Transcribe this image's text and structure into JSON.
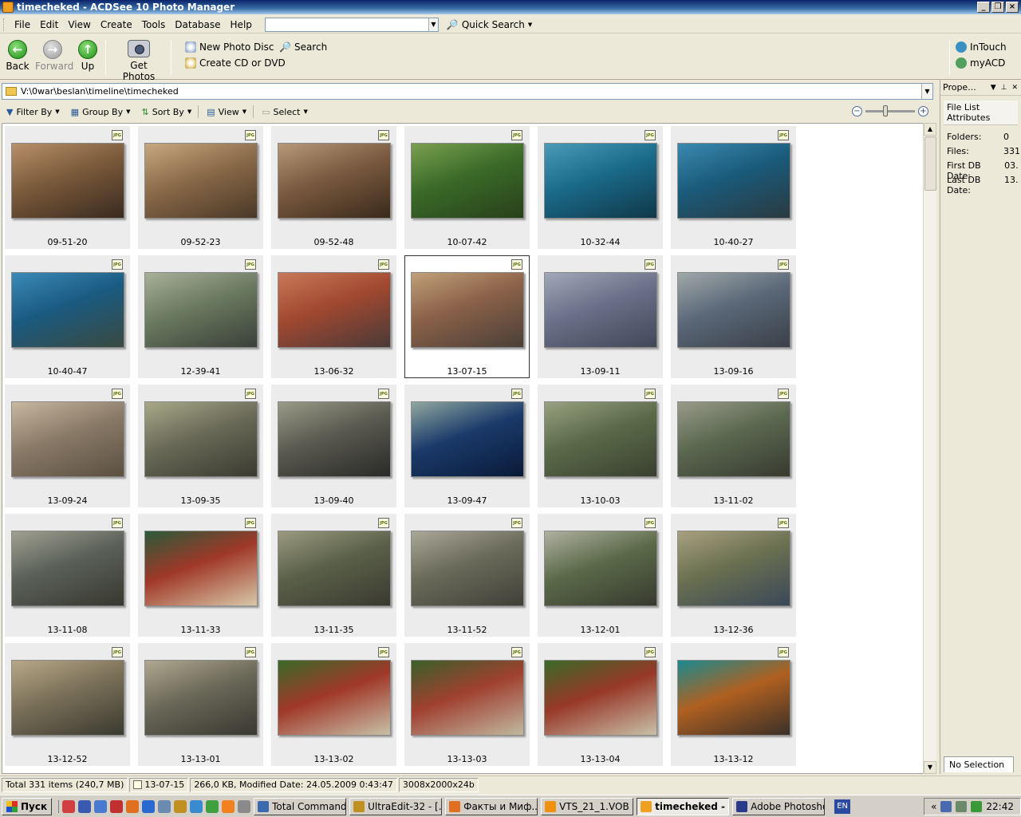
{
  "window": {
    "title": "timecheked - ACDSee 10 Photo Manager"
  },
  "menu": {
    "items": [
      "File",
      "Edit",
      "View",
      "Create",
      "Tools",
      "Database",
      "Help"
    ],
    "search_value": "",
    "quick_search": "Quick Search"
  },
  "toolbar": {
    "back": "Back",
    "forward": "Forward",
    "up": "Up",
    "get_photos": "Get Photos",
    "new_photo_disc": "New Photo Disc",
    "create_cd": "Create CD or DVD",
    "search": "Search",
    "intouch": "InTouch",
    "myacd": "myACD"
  },
  "address": {
    "path": "V:\\0war\\beslan\\timeline\\timecheked"
  },
  "filterbar": {
    "filter_by": "Filter By",
    "group_by": "Group By",
    "sort_by": "Sort By",
    "view": "View",
    "select": "Select"
  },
  "files": {
    "badge": "JPG",
    "selected": "13-07-15",
    "items": [
      {
        "name": "09-51-20",
        "colors": [
          "#7a5a3a",
          "#b8906a",
          "#3a2a20"
        ]
      },
      {
        "name": "09-52-23",
        "colors": [
          "#8a6a48",
          "#c8a880",
          "#4a3828"
        ]
      },
      {
        "name": "09-52-48",
        "colors": [
          "#7a5a40",
          "#b89878",
          "#3a2a1a"
        ]
      },
      {
        "name": "10-07-42",
        "colors": [
          "#3a6a28",
          "#7aa050",
          "#28401a"
        ]
      },
      {
        "name": "10-32-44",
        "colors": [
          "#1a6a8a",
          "#4a9ab8",
          "#103848"
        ]
      },
      {
        "name": "10-40-27",
        "colors": [
          "#1a5a7a",
          "#3a8ab0",
          "#2a3a40"
        ]
      },
      {
        "name": "10-40-47",
        "colors": [
          "#1a5a80",
          "#3a8ab8",
          "#3a4a40"
        ]
      },
      {
        "name": "12-39-41",
        "colors": [
          "#6a7a60",
          "#a8b098",
          "#3a4038"
        ]
      },
      {
        "name": "13-06-32",
        "colors": [
          "#a04830",
          "#c87858",
          "#4a3a38"
        ]
      },
      {
        "name": "13-07-15",
        "colors": [
          "#8a6048",
          "#c0a078",
          "#4a4038"
        ]
      },
      {
        "name": "13-09-11",
        "colors": [
          "#6a7088",
          "#a0a8b8",
          "#404858"
        ]
      },
      {
        "name": "13-09-16",
        "colors": [
          "#5a6878",
          "#a0a8a8",
          "#3a4048"
        ]
      },
      {
        "name": "13-09-24",
        "colors": [
          "#8a7a68",
          "#c8b8a0",
          "#5a5040"
        ]
      },
      {
        "name": "13-09-35",
        "colors": [
          "#6a6a58",
          "#a8a888",
          "#3a3a30"
        ]
      },
      {
        "name": "13-09-40",
        "colors": [
          "#5a5a50",
          "#9a9a88",
          "#2a2a28"
        ]
      },
      {
        "name": "13-09-47",
        "colors": [
          "#1a3a6a",
          "#90a8a0",
          "#0a1a38"
        ]
      },
      {
        "name": "13-10-03",
        "colors": [
          "#5a6a48",
          "#98a080",
          "#3a4030"
        ]
      },
      {
        "name": "13-11-02",
        "colors": [
          "#5a6850",
          "#989a88",
          "#383a30"
        ]
      },
      {
        "name": "13-11-08",
        "colors": [
          "#5a6058",
          "#a0a090",
          "#383830"
        ]
      },
      {
        "name": "13-11-33",
        "colors": [
          "#a03828",
          "#2a5a3a",
          "#d8c8a8"
        ]
      },
      {
        "name": "13-11-35",
        "colors": [
          "#5a6048",
          "#9a9a80",
          "#3a3a30"
        ]
      },
      {
        "name": "13-11-52",
        "colors": [
          "#6a6a5a",
          "#aaa898",
          "#404038"
        ]
      },
      {
        "name": "13-12-01",
        "colors": [
          "#5a6a48",
          "#b0b0a0",
          "#383a30"
        ]
      },
      {
        "name": "13-12-36",
        "colors": [
          "#6a7050",
          "#a8a080",
          "#3a4858"
        ]
      },
      {
        "name": "13-12-52",
        "colors": [
          "#7a7058",
          "#b8a888",
          "#3a3a30"
        ]
      },
      {
        "name": "13-13-01",
        "colors": [
          "#6a6858",
          "#b0a890",
          "#3a3830"
        ]
      },
      {
        "name": "13-13-02",
        "colors": [
          "#a03828",
          "#3a6a28",
          "#c8c0a8"
        ]
      },
      {
        "name": "13-13-03",
        "colors": [
          "#a04030",
          "#3a6028",
          "#c0b8a0"
        ]
      },
      {
        "name": "13-13-04",
        "colors": [
          "#983828",
          "#3a6a28",
          "#c8c0a8"
        ]
      },
      {
        "name": "13-13-12",
        "colors": [
          "#b06020",
          "#1a8a90",
          "#3a3028"
        ]
      }
    ]
  },
  "properties": {
    "title": "Prope...",
    "tab": "File List Attributes",
    "attrs": [
      {
        "label": "Folders:",
        "value": "0"
      },
      {
        "label": "Files:",
        "value": "331"
      },
      {
        "label": "First DB Date:",
        "value": "03."
      },
      {
        "label": "Last DB Date:",
        "value": "13."
      }
    ],
    "no_selection": "No Selection"
  },
  "status": {
    "total": "Total 331 items  (240,7 MB)",
    "current": "13-07-15",
    "info": "266,0 KB, Modified Date: 24.05.2009 0:43:47",
    "dims": "3008x2000x24b"
  },
  "taskbar": {
    "start": "Пуск",
    "tasks": [
      {
        "label": "Total Command...",
        "color": "#3a6ab0"
      },
      {
        "label": "UltraEdit-32 - [...",
        "color": "#c09020"
      },
      {
        "label": "Факты и Миф...",
        "color": "#e07020"
      },
      {
        "label": "VTS_21_1.VOB ...",
        "color": "#f09010"
      },
      {
        "label": "timecheked - ...",
        "color": "#f0a020"
      },
      {
        "label": "Adobe Photoshop",
        "color": "#2a3a8a"
      }
    ],
    "active_task": "timecheked - ...",
    "lang": "EN",
    "clock": "22:42"
  }
}
